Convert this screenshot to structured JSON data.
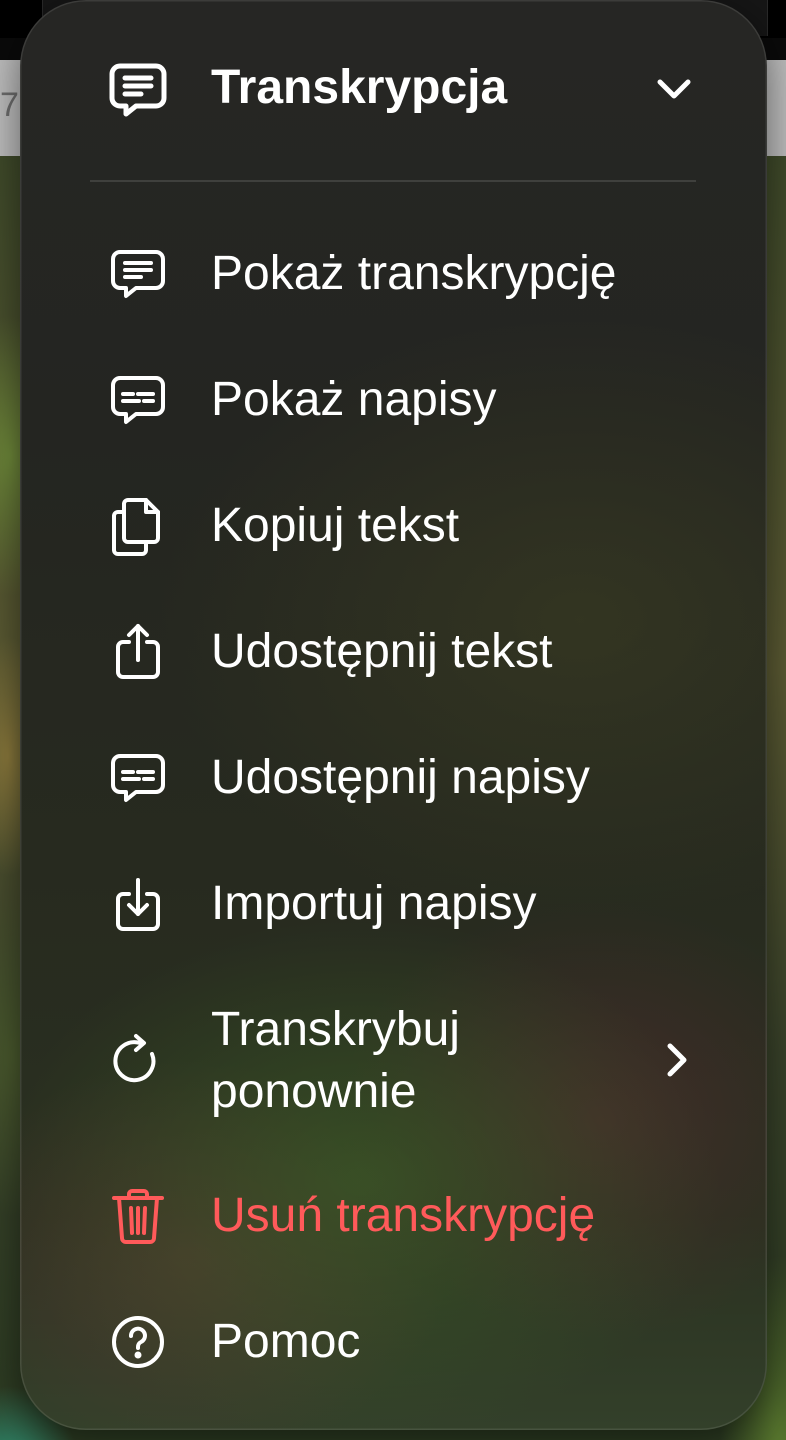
{
  "background": {
    "partial_digit": "7"
  },
  "menu": {
    "header": {
      "title": "Transkrypcja",
      "icon": "transcript-bubble-icon",
      "expand_icon": "chevron-down-icon"
    },
    "items": [
      {
        "label": "Pokaż transkrypcję",
        "icon": "transcript-bubble-icon"
      },
      {
        "label": "Pokaż napisy",
        "icon": "captions-bubble-icon"
      },
      {
        "label": "Kopiuj tekst",
        "icon": "copy-icon"
      },
      {
        "label": "Udostępnij tekst",
        "icon": "share-icon"
      },
      {
        "label": "Udostępnij napisy",
        "icon": "captions-bubble-icon"
      },
      {
        "label": "Importuj napisy",
        "icon": "import-icon"
      },
      {
        "label": "Transkrybuj ponownie",
        "icon": "redo-icon",
        "submenu_icon": "chevron-right-icon"
      },
      {
        "label": "Usuń transkrypcję",
        "icon": "trash-icon",
        "destructive": true
      },
      {
        "label": "Pomoc",
        "icon": "help-circle-icon"
      }
    ]
  },
  "colors": {
    "text": "#ffffff",
    "destructive": "#ff5a5a",
    "divider": "rgba(255,255,255,0.12)"
  }
}
